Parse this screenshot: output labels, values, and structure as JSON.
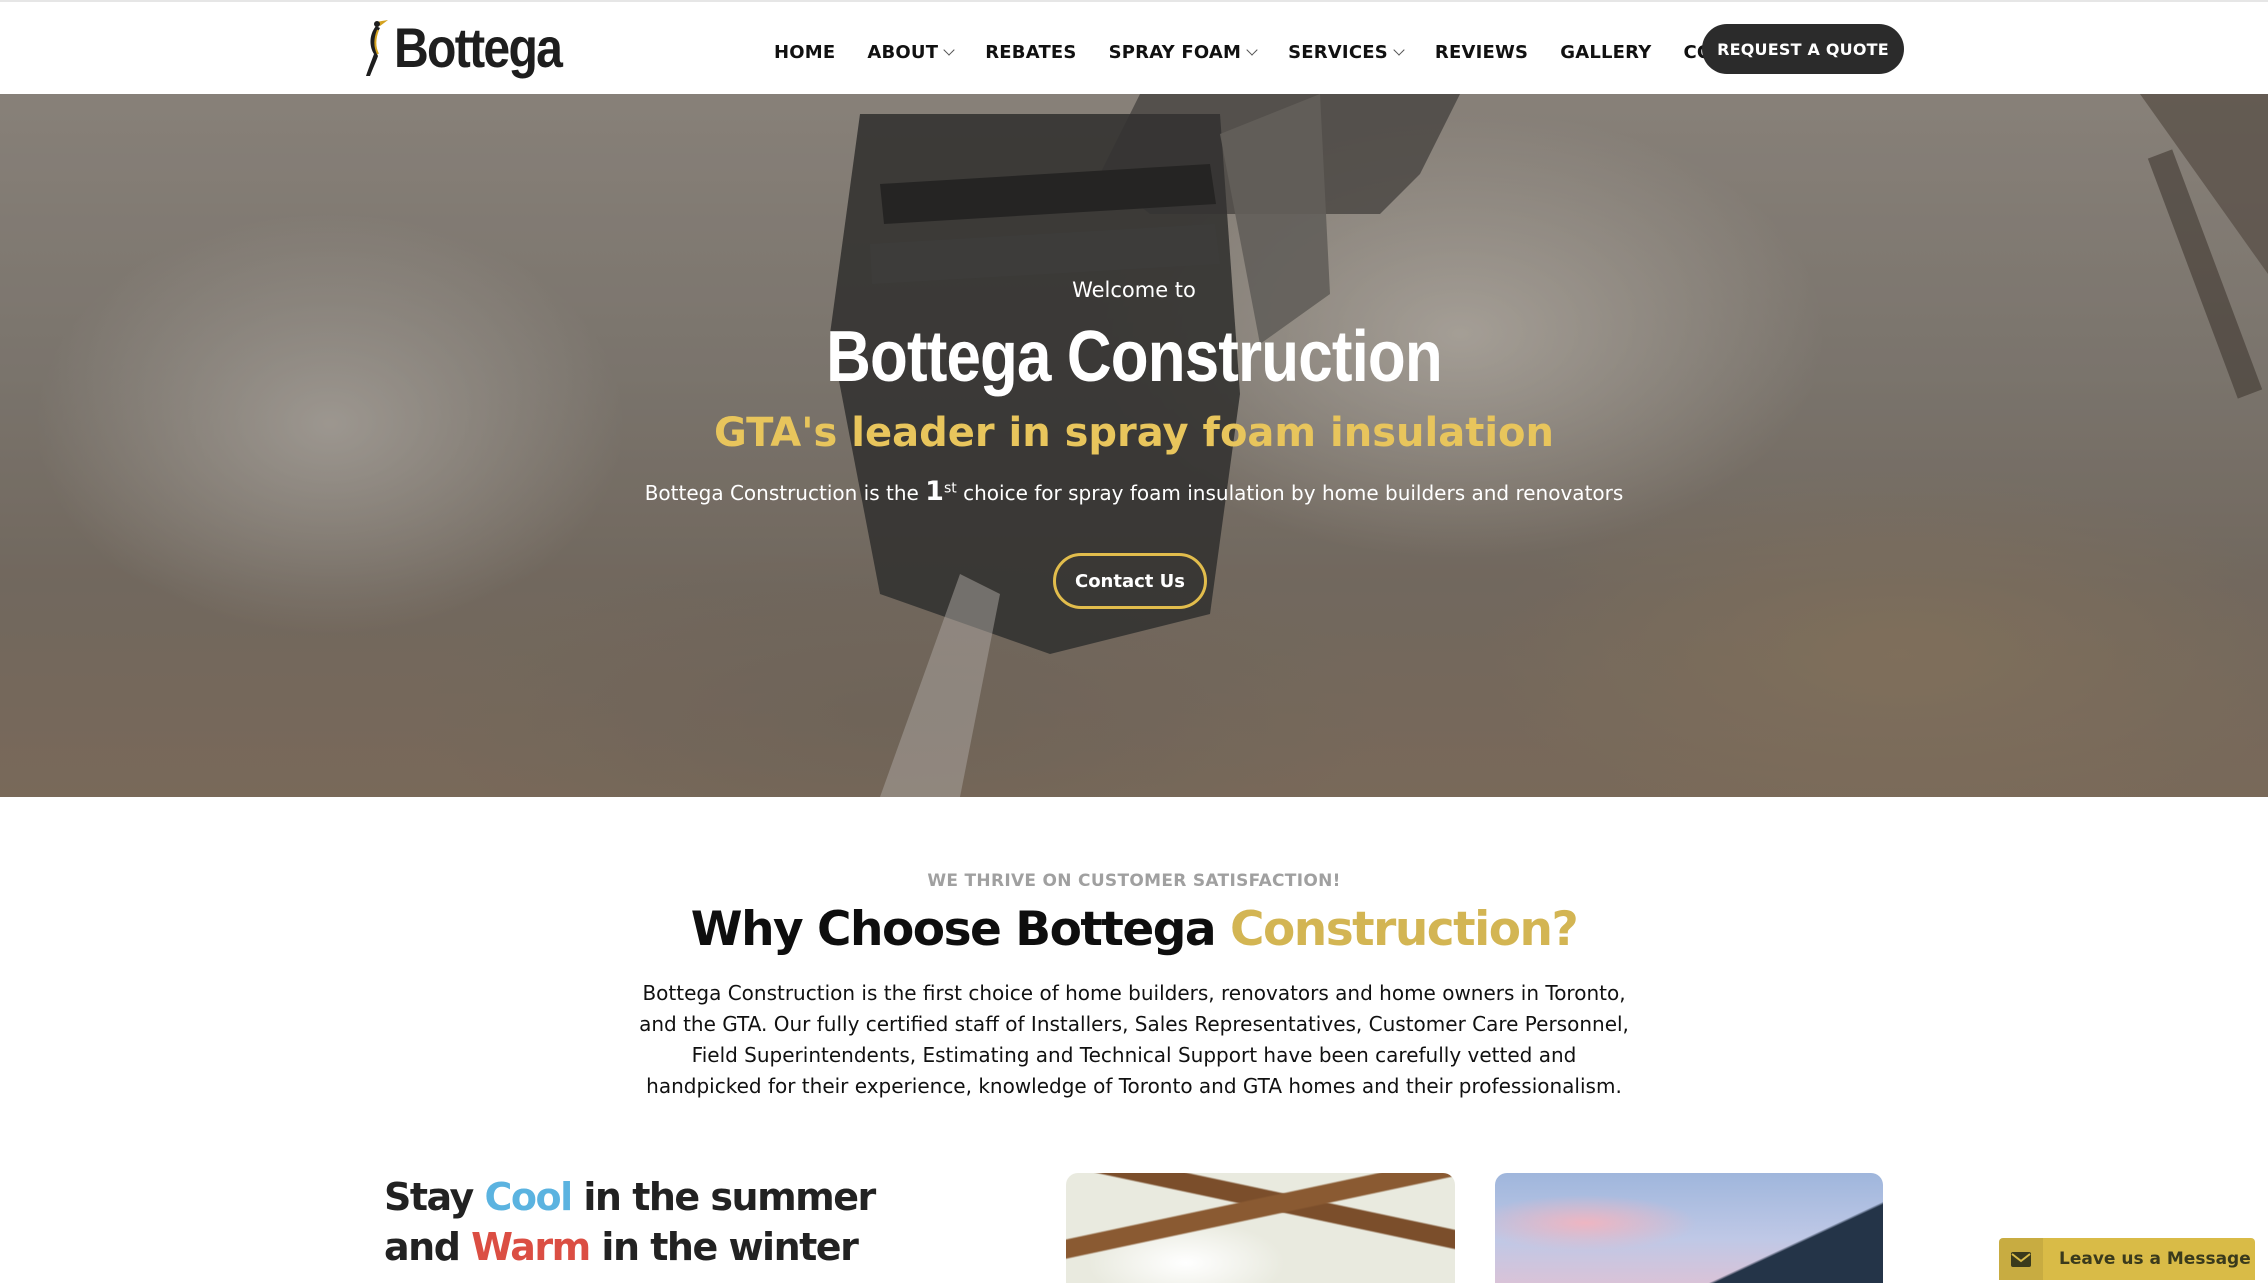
{
  "header": {
    "logo_text": "Bottega",
    "nav": [
      {
        "label": "HOME",
        "dropdown": false
      },
      {
        "label": "ABOUT",
        "dropdown": true
      },
      {
        "label": "REBATES",
        "dropdown": false
      },
      {
        "label": "SPRAY FOAM",
        "dropdown": true
      },
      {
        "label": "SERVICES",
        "dropdown": true
      },
      {
        "label": "REVIEWS",
        "dropdown": false
      },
      {
        "label": "GALLERY",
        "dropdown": false
      },
      {
        "label": "CONTACT",
        "dropdown": false
      }
    ],
    "cta_label": "REQUEST A QUOTE"
  },
  "hero": {
    "welcome": "Welcome to",
    "title": "Bottega Construction",
    "tagline": "GTA's leader in spray foam insulation",
    "sub_before": "Bottega Construction is the ",
    "sub_number": "1",
    "sub_sup": "st",
    "sub_after": " choice for spray foam insulation by home builders and renovators",
    "button_label": "Contact Us"
  },
  "why": {
    "kicker": "WE THRIVE ON CUSTOMER SATISFACTION!",
    "title_main": "Why Choose Bottega ",
    "title_accent": "Construction?",
    "body": "Bottega Construction is the first choice of home builders, renovators and home owners in Toronto, and the GTA. Our fully certified staff of Installers, Sales Representatives, Customer Care Personnel, Field Superintendents, Estimating and Technical Support have been carefully vetted and handpicked for their experience, knowledge of Toronto and GTA homes and their professionalism."
  },
  "feature": {
    "line1_a": "Stay ",
    "line1_cool": "Cool",
    "line1_b": " in the summer",
    "line2_a": "and ",
    "line2_warm": "Warm",
    "line2_b": " in the winter"
  },
  "chat": {
    "label": "Leave us a Message"
  },
  "colors": {
    "accent_gold": "#d3b553",
    "tagline_gold": "#e8c55c",
    "cool_blue": "#5bb3e0",
    "warm_red": "#db4e43",
    "dark_button": "#2b2b2b"
  },
  "icons": {
    "logo_mark": "heron-bird-icon",
    "chat": "envelope-icon",
    "dropdown": "chevron-down-icon"
  }
}
